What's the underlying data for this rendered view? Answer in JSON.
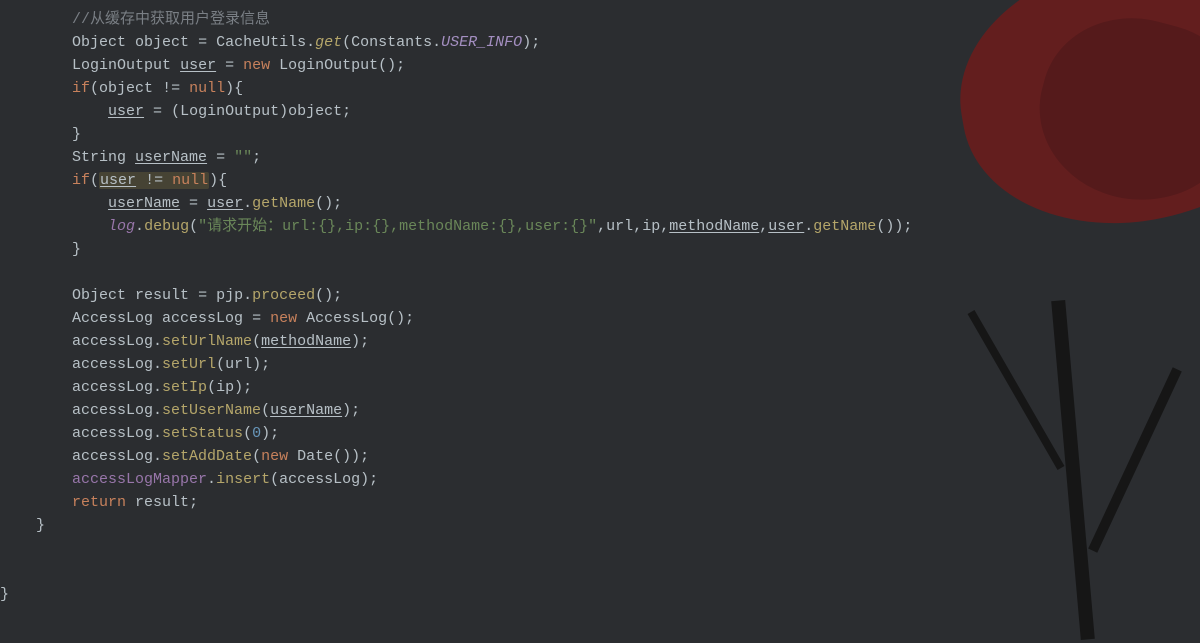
{
  "code": {
    "indent1": "        ",
    "indent2": "            ",
    "indent0": "    ",
    "comment": "//从缓存中获取用户登录信息",
    "t_Object": "Object",
    "v_object": "object",
    "eq": " = ",
    "v_CacheUtils": "CacheUtils",
    "m_get": "get",
    "v_Constants": "Constants",
    "f_USER_INFO": "USER_INFO",
    "semi": ";",
    "t_LoginOutput": "LoginOutput",
    "v_user": "user",
    "kw_new": "new",
    "paren_pair": "()",
    "kw_if": "if",
    "neq_null": " != ",
    "kw_null": "null",
    "lbrace": "{",
    "rbrace": "}",
    "cast_LoginOutput": "(LoginOutput)",
    "t_String": "String",
    "v_userName": "userName",
    "s_empty": "\"\"",
    "m_getName": "getName",
    "f_log": "log",
    "m_debug": "debug",
    "s_log": "\"请求开始：url:{},ip:{},methodName:{},user:{}\"",
    "v_url": "url",
    "v_ip": "ip",
    "v_methodName": "methodName",
    "v_result": "result",
    "v_pjp": "pjp",
    "m_proceed": "proceed",
    "t_AccessLog": "AccessLog",
    "v_accessLog": "accessLog",
    "m_setUrlName": "setUrlName",
    "m_setUrl": "setUrl",
    "m_setIp": "setIp",
    "m_setUserName": "setUserName",
    "m_setStatus": "setStatus",
    "n_zero": "0",
    "m_setAddDate": "setAddDate",
    "t_Date": "Date",
    "f_accessLogMapper": "accessLogMapper",
    "m_insert": "insert",
    "kw_return": "return",
    "dot": ".",
    "lp": "(",
    "rp": ")",
    "comma": ",",
    "rbrace_outer": "}"
  }
}
